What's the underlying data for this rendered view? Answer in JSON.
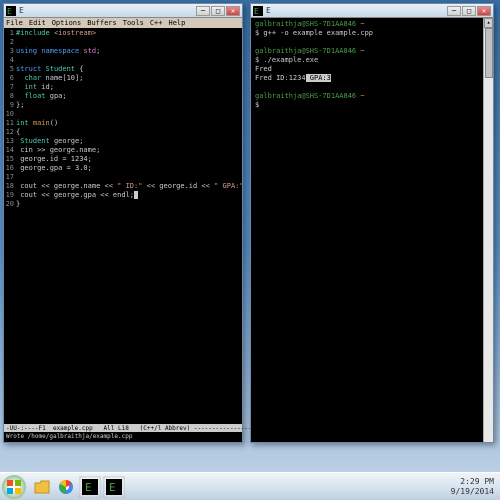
{
  "editor": {
    "title": "E",
    "menu": [
      "File",
      "Edit",
      "Options",
      "Buffers",
      "Tools",
      "C++",
      "Help"
    ],
    "lines": [
      {
        "n": "1",
        "html": "<span class='kw-include'>#include</span> <span class='kw-str'>&lt;iostream&gt;</span>"
      },
      {
        "n": "2",
        "html": ""
      },
      {
        "n": "3",
        "html": "<span class='kw-blue'>using namespace</span> <span class='kw-pink'>std</span>;"
      },
      {
        "n": "4",
        "html": ""
      },
      {
        "n": "5",
        "html": "<span class='kw-blue'>struct</span> <span class='kw-type'>Student</span> {"
      },
      {
        "n": "6",
        "html": "  <span class='kw-type'>char</span> name[10];"
      },
      {
        "n": "7",
        "html": "  <span class='kw-type'>int</span> id;"
      },
      {
        "n": "8",
        "html": "  <span class='kw-type'>float</span> gpa;"
      },
      {
        "n": "9",
        "html": "};"
      },
      {
        "n": "10",
        "html": ""
      },
      {
        "n": "11",
        "html": "<span class='kw-type'>int</span> <span class='kw-func'>main</span>()"
      },
      {
        "n": "12",
        "html": "{"
      },
      {
        "n": "13",
        "html": " <span class='kw-type'>Student</span> george;"
      },
      {
        "n": "14",
        "html": " cin &gt;&gt; george.name;"
      },
      {
        "n": "15",
        "html": " george.id = 1234;"
      },
      {
        "n": "16",
        "html": " george.gpa = 3.0;"
      },
      {
        "n": "17",
        "html": ""
      },
      {
        "n": "18",
        "html": " cout &lt;&lt; george.name &lt;&lt; <span class='kw-str'>\" ID:\"</span> &lt;&lt; george.id &lt;&lt; <span class='kw-str'>\" GPA:\"</span>;"
      },
      {
        "n": "19",
        "html": " cout &lt;&lt; george.gpa &lt;&lt; endl;<span style='background:#ccc;color:#000'> </span>"
      },
      {
        "n": "20",
        "html": "}"
      }
    ],
    "status": "-UU-:----F1  example.cpp   All L18   (C++/l Abbrev) ------------------",
    "status2": "Wrote /home/galbraithja/example.cpp"
  },
  "terminal": {
    "title": "E",
    "prompt": "galbraithja@SHS-7D1AA846",
    "tilde": " ~",
    "lines": [
      {
        "type": "prompt",
        "cmd": "$ g++ -o example example.cpp"
      },
      {
        "type": "blank"
      },
      {
        "type": "prompt",
        "cmd": "$ ./example.exe"
      },
      {
        "type": "out",
        "text": "Fred"
      },
      {
        "type": "outhl",
        "pre": "Fred ID:1234",
        "hl": " GPA:3"
      },
      {
        "type": "blank"
      },
      {
        "type": "prompt",
        "cmd": "$ "
      }
    ]
  },
  "taskbar": {
    "time": "2:29 PM",
    "date": "9/19/2014"
  },
  "colors": {
    "bg": "#000000",
    "prompt": "#4a9e4a"
  }
}
